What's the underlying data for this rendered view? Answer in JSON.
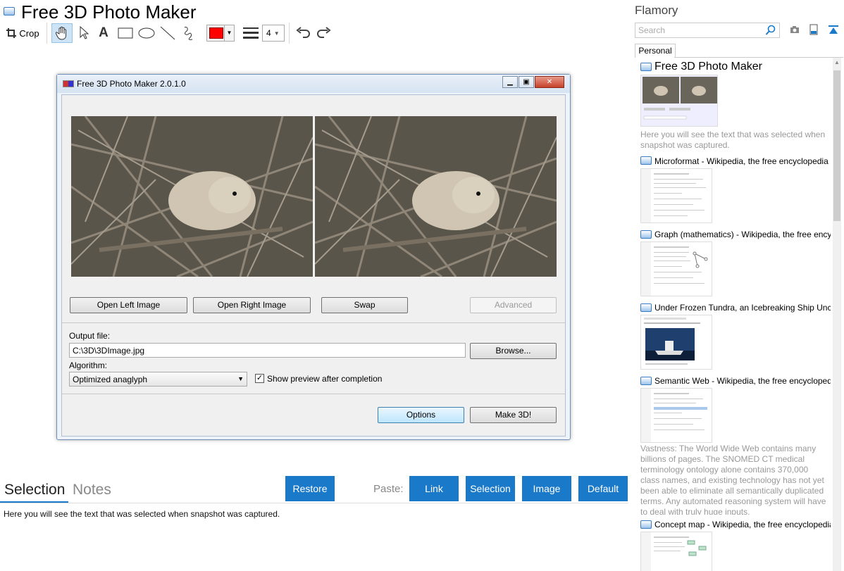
{
  "app": {
    "title": "Free 3D Photo Maker"
  },
  "toolbar": {
    "crop_label": "Crop",
    "stroke_color": "#ff0000",
    "line_width": "4"
  },
  "capture": {
    "window_title": "Free 3D Photo Maker 2.0.1.0",
    "buttons": {
      "open_left": "Open Left Image",
      "open_right": "Open Right Image",
      "swap": "Swap",
      "advanced": "Advanced",
      "browse": "Browse...",
      "options": "Options",
      "make3d": "Make 3D!"
    },
    "output_label": "Output file:",
    "output_value": "C:\\3D\\3DImage.jpg",
    "algorithm_label": "Algorithm:",
    "algorithm_value": "Optimized anaglyph",
    "preview_label": "Show preview after completion",
    "preview_checked": true
  },
  "bottom": {
    "tabs": {
      "selection": "Selection",
      "notes": "Notes"
    },
    "restore": "Restore",
    "paste_label": "Paste:",
    "paste_buttons": {
      "link": "Link",
      "selection": "Selection",
      "image": "Image",
      "default": "Default"
    },
    "selection_text": "Here you will see the text that was selected when snapshot was captured.",
    "accent": "#1a79c9"
  },
  "sidebar": {
    "title": "Flamory",
    "search_placeholder": "Search",
    "tab": "Personal",
    "entries": [
      {
        "title": "Free 3D Photo Maker",
        "desc": "Here you will see the text that was selected when snapshot was captured."
      },
      {
        "title": "Microformat - Wikipedia, the free encyclopedia"
      },
      {
        "title": "Graph (mathematics) - Wikipedia, the free encyclopedia"
      },
      {
        "title": "Under Frozen Tundra, an Icebreaking Ship Uncovers"
      },
      {
        "title": "Semantic Web - Wikipedia, the free encyclopedia",
        "desc": "Vastness: The World Wide Web contains many billions of pages. The SNOMED CT medical terminology ontology alone contains 370,000 class names, and existing technology has not yet been able to eliminate all semantically duplicated terms. Any automated reasoning system will have to deal with truly huge inputs."
      },
      {
        "title": "Concept map - Wikipedia, the free encyclopedia"
      }
    ]
  }
}
